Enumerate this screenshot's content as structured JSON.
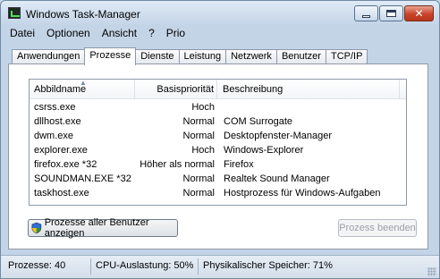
{
  "window": {
    "title": "Windows Task-Manager"
  },
  "menu": [
    "Datei",
    "Optionen",
    "Ansicht",
    "?",
    "Prio"
  ],
  "tabs": [
    {
      "label": "Anwendungen",
      "active": false
    },
    {
      "label": "Prozesse",
      "active": true
    },
    {
      "label": "Dienste",
      "active": false
    },
    {
      "label": "Leistung",
      "active": false
    },
    {
      "label": "Netzwerk",
      "active": false
    },
    {
      "label": "Benutzer",
      "active": false
    },
    {
      "label": "TCP/IP",
      "active": false
    }
  ],
  "table": {
    "columns": [
      "Abbildname",
      "Basispriorität",
      "Beschreibung"
    ],
    "sorted_column": "Abbildname",
    "rows": [
      {
        "name": "csrss.exe",
        "priority": "Hoch",
        "description": ""
      },
      {
        "name": "dllhost.exe",
        "priority": "Normal",
        "description": "COM Surrogate"
      },
      {
        "name": "dwm.exe",
        "priority": "Normal",
        "description": "Desktopfenster-Manager"
      },
      {
        "name": "explorer.exe",
        "priority": "Hoch",
        "description": "Windows-Explorer"
      },
      {
        "name": "firefox.exe *32",
        "priority": "Höher als normal",
        "description": "Firefox"
      },
      {
        "name": "SOUNDMAN.EXE *32",
        "priority": "Normal",
        "description": "Realtek Sound Manager"
      },
      {
        "name": "taskhost.exe",
        "priority": "Normal",
        "description": "Hostprozess für Windows-Aufgaben"
      }
    ]
  },
  "buttons": {
    "show_all": "Prozesse aller Benutzer anzeigen",
    "end_process": "Prozess beenden"
  },
  "status": {
    "processes": "Prozesse: 40",
    "cpu": "CPU-Auslastung: 50%",
    "memory": "Physikalischer Speicher: 71%"
  },
  "icons": {
    "app": "task-manager-icon",
    "shield": "uac-shield-icon"
  }
}
